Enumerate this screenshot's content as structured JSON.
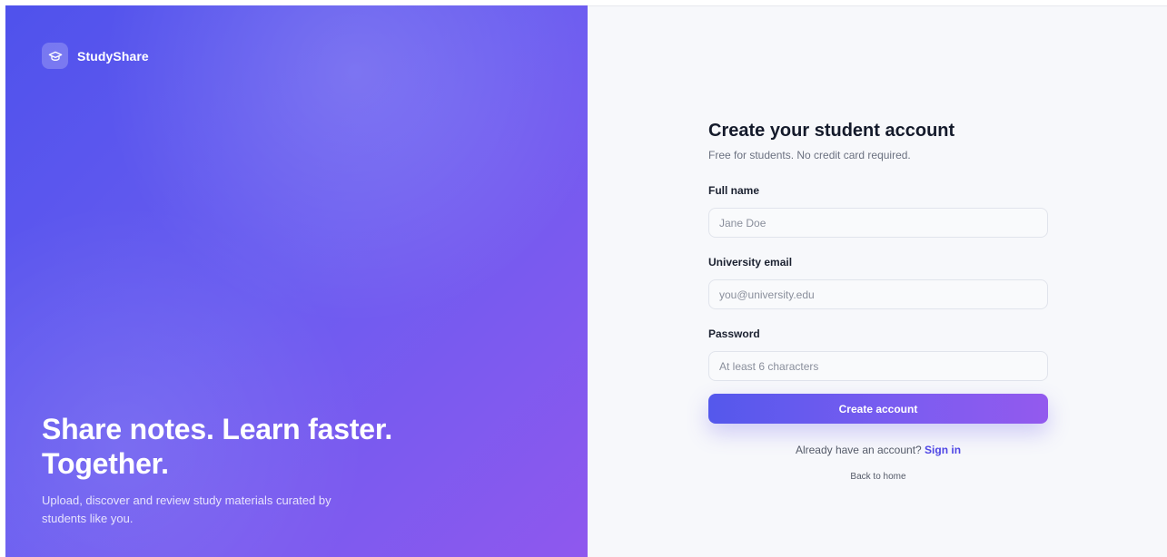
{
  "brand": {
    "name": "StudyShare",
    "icon": "graduation-cap-icon"
  },
  "hero": {
    "title_line1": "Share notes. Learn faster.",
    "title_line2": "Together.",
    "subtitle": "Upload, discover and review study materials curated by students like you."
  },
  "form": {
    "title": "Create your student account",
    "subtitle": "Free for students. No credit card required.",
    "full_name": {
      "label": "Full name",
      "placeholder": "Jane Doe",
      "value": ""
    },
    "email": {
      "label": "University email",
      "placeholder": "you@university.edu",
      "value": ""
    },
    "password": {
      "label": "Password",
      "placeholder": "At least 6 characters",
      "value": ""
    },
    "submit_label": "Create account",
    "signin_prompt": "Already have an account?",
    "signin_link": "Sign in",
    "back_link": "Back to home"
  },
  "colors": {
    "accent": "#4f46e5",
    "gradient_start": "#4f52ec",
    "gradient_end": "#8f58ee",
    "panel_background": "#f7f8fb"
  }
}
